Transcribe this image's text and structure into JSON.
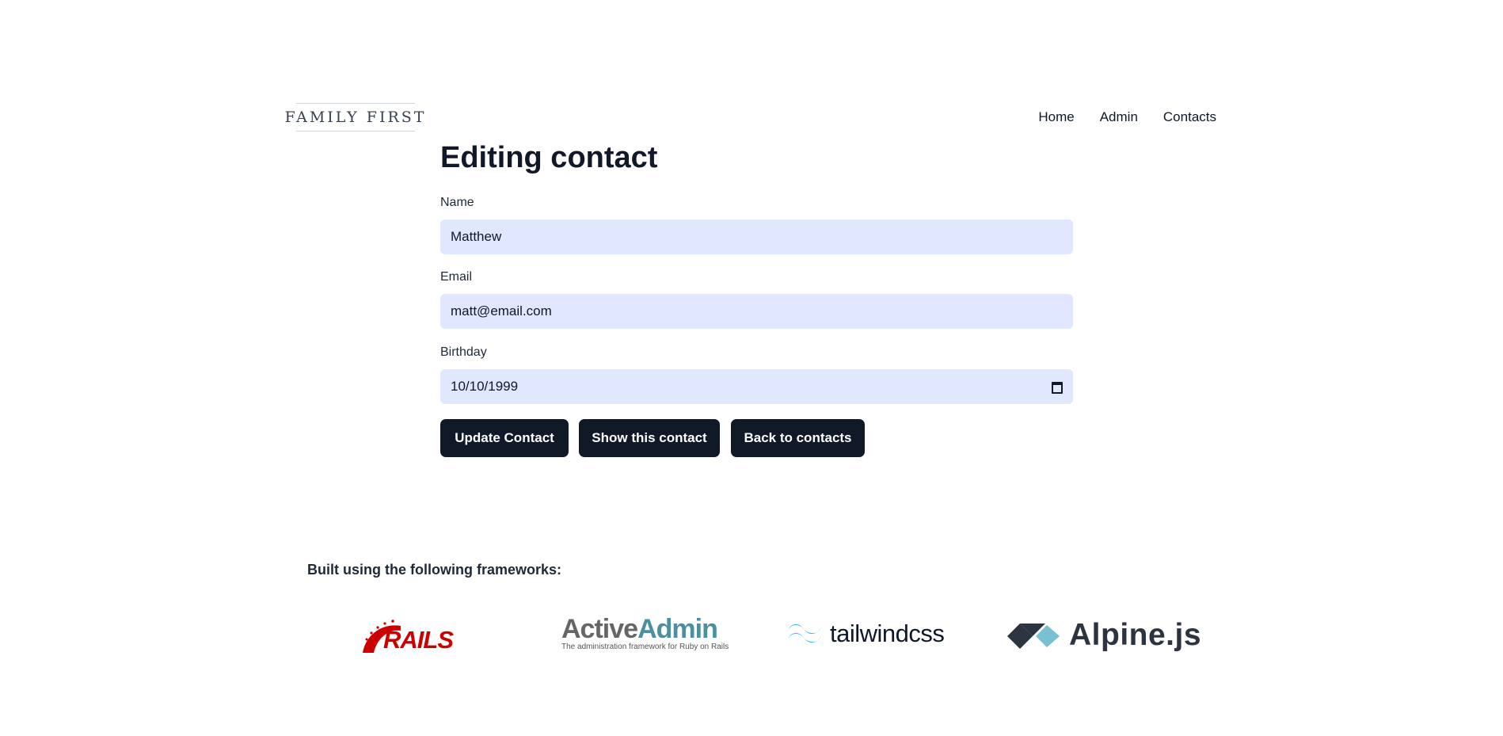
{
  "brand": {
    "logo_text": "FAMILY FIRST"
  },
  "nav": {
    "items": [
      "Home",
      "Admin",
      "Contacts"
    ]
  },
  "page": {
    "title": "Editing contact"
  },
  "form": {
    "name": {
      "label": "Name",
      "value": "Matthew"
    },
    "email": {
      "label": "Email",
      "value": "matt@email.com"
    },
    "birthday": {
      "label": "Birthday",
      "value": "10/10/1999",
      "icon": "calendar-icon"
    }
  },
  "actions": {
    "update_label": "Update Contact",
    "show_label": "Show this contact",
    "back_label": "Back to contacts"
  },
  "footer": {
    "heading": "Built using the following frameworks:",
    "frameworks": [
      {
        "name": "Rails",
        "logo_text": "RAILS",
        "color": "#cc0000"
      },
      {
        "name": "ActiveAdmin",
        "logo_text_a": "Active",
        "logo_text_b": "Admin",
        "tagline": "The administration framework for Ruby on Rails",
        "colors": [
          "#666666",
          "#4c8f9f"
        ]
      },
      {
        "name": "Tailwind CSS",
        "logo_text": "tailwindcss",
        "color": "#38bdf8"
      },
      {
        "name": "Alpine.js",
        "logo_text": "Alpine.js",
        "colors": [
          "#2d3441",
          "#77c1d2"
        ]
      }
    ]
  },
  "colors": {
    "accent": "#111827",
    "input_bg": "#e0e7ff"
  }
}
